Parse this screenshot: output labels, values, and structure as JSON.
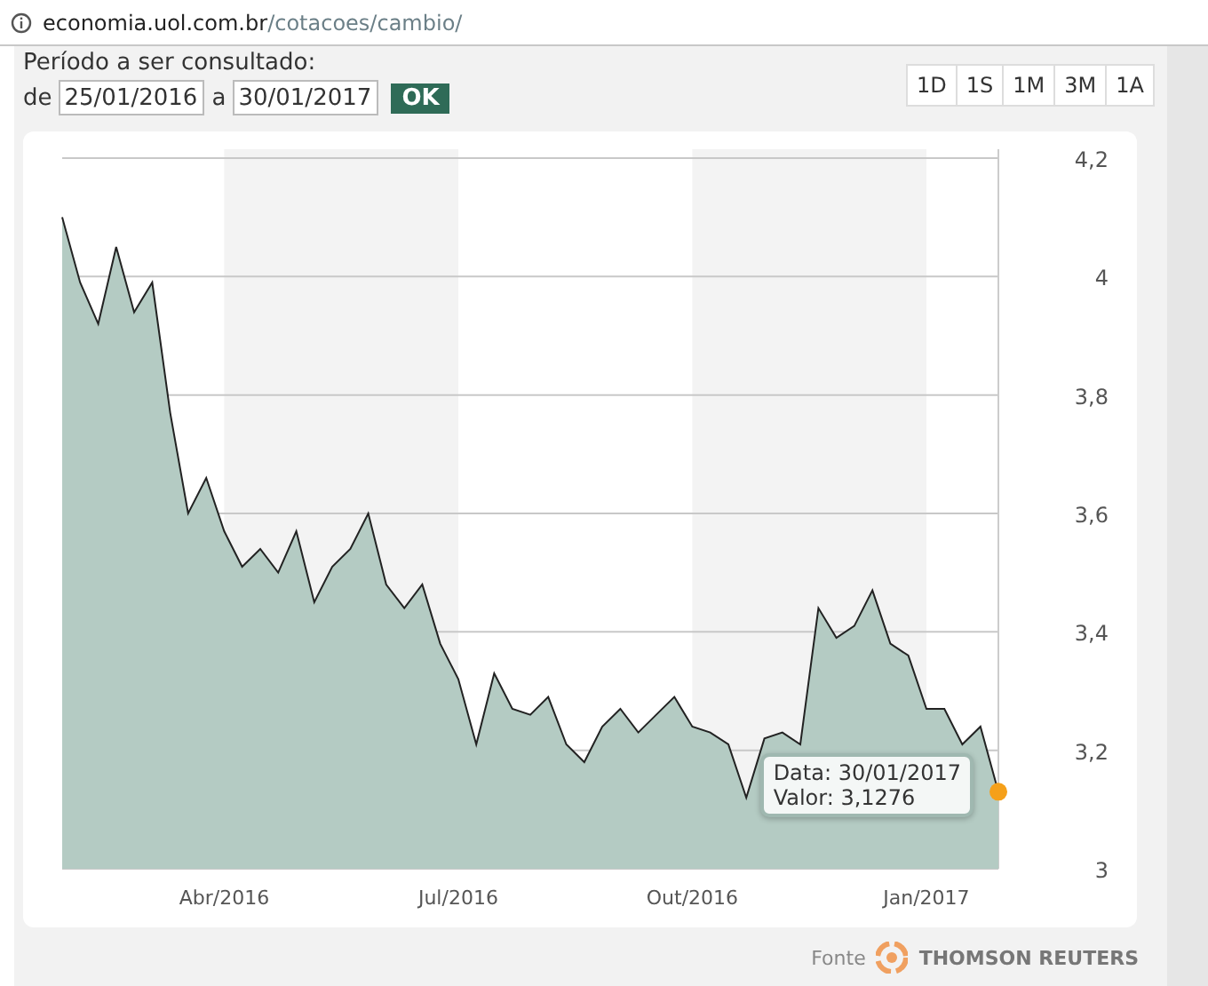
{
  "address_bar": {
    "host": "economia.uol.com.br",
    "path": "/cotacoes/cambio/"
  },
  "period_form": {
    "label": "Período a ser consultado:",
    "from_label": "de",
    "from_value": "25/01/2016",
    "to_label": "a",
    "to_value": "30/01/2017",
    "submit": "OK"
  },
  "range_buttons": [
    {
      "label": "1D",
      "selected": false
    },
    {
      "label": "1S",
      "selected": false
    },
    {
      "label": "1M",
      "selected": false
    },
    {
      "label": "3M",
      "selected": false
    },
    {
      "label": "1A",
      "selected": false
    }
  ],
  "chart": {
    "chart_data": {
      "type": "area",
      "categories": [
        null,
        null,
        null,
        null,
        null,
        null,
        null,
        null,
        null,
        "Abr/2016",
        null,
        null,
        null,
        null,
        null,
        null,
        null,
        null,
        null,
        null,
        null,
        null,
        "Jul/2016",
        null,
        null,
        null,
        null,
        null,
        null,
        null,
        null,
        null,
        null,
        null,
        null,
        "Out/2016",
        null,
        null,
        null,
        null,
        null,
        null,
        null,
        null,
        null,
        null,
        null,
        null,
        "Jan/2017",
        null,
        null,
        null,
        null
      ],
      "series": [
        {
          "color": "#222222",
          "values": [
            4.1,
            3.99,
            3.92,
            4.05,
            3.94,
            3.99,
            3.77,
            3.6,
            3.66,
            3.57,
            3.51,
            3.54,
            3.5,
            3.57,
            3.45,
            3.51,
            3.54,
            3.6,
            3.48,
            3.44,
            3.48,
            3.38,
            3.32,
            3.21,
            3.33,
            3.27,
            3.26,
            3.29,
            3.21,
            3.18,
            3.24,
            3.27,
            3.23,
            3.26,
            3.29,
            3.24,
            3.23,
            3.21,
            3.12,
            3.22,
            3.23,
            3.21,
            3.44,
            3.39,
            3.41,
            3.47,
            3.38,
            3.36,
            3.27,
            3.27,
            3.21,
            3.24,
            3.13
          ]
        }
      ],
      "ylim": [
        3,
        4.2
      ],
      "grid": true,
      "yticks": [
        {
          "value": 3,
          "label": "3"
        },
        {
          "value": 3.2,
          "label": "3,2"
        },
        {
          "value": 3.4,
          "label": "3,4"
        },
        {
          "value": 3.6,
          "label": "3,6"
        },
        {
          "value": 3.8,
          "label": "3,8"
        },
        {
          "value": 4,
          "label": "4"
        },
        {
          "value": 4.2,
          "label": "4,2"
        }
      ]
    },
    "tooltip": {
      "date": "Data: 30/01/2017",
      "value": "Valor: 3,1276"
    }
  },
  "source": {
    "label": "Fonte",
    "provider": "THOMSON REUTERS"
  }
}
